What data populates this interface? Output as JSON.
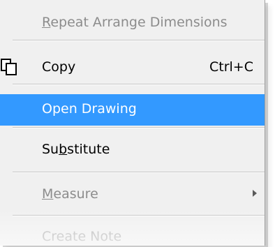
{
  "menu": {
    "items": [
      {
        "label": "Repeat Arrange Dimensions",
        "accel_char": "R",
        "label_rest": "epeat Arrange Dimensions",
        "state": "disabled"
      },
      {
        "label": "Copy",
        "shortcut": "Ctrl+C",
        "icon": "copy-icon",
        "state": "enabled"
      },
      {
        "label": "Open Drawing",
        "state": "highlighted"
      },
      {
        "label": "Substitute",
        "label_pre": "Su",
        "accel_char": "b",
        "label_post": "stitute",
        "state": "enabled"
      },
      {
        "label": "Measure",
        "accel_char": "M",
        "label_rest": "easure",
        "state": "disabled",
        "has_submenu": true
      },
      {
        "label": "Create Note",
        "state": "disabled"
      }
    ],
    "highlight_color": "#3399ff"
  }
}
